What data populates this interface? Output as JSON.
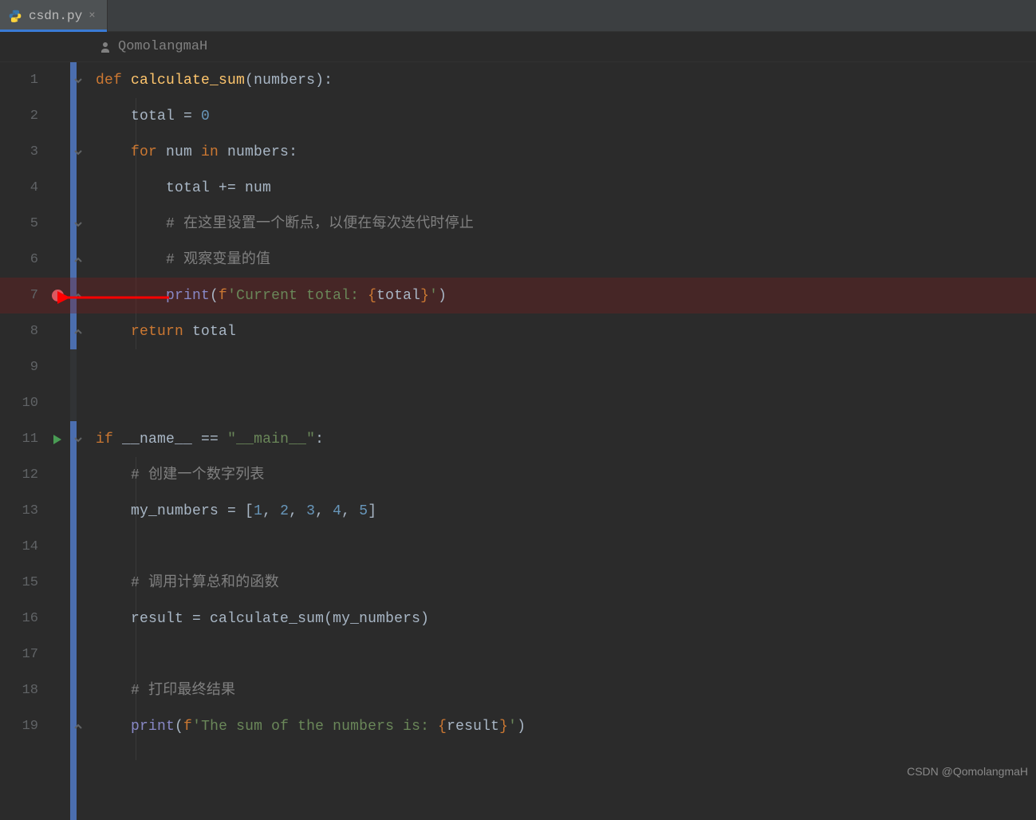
{
  "tab": {
    "filename": "csdn.py",
    "close_glyph": "×"
  },
  "author": {
    "name": "QomolangmaH"
  },
  "breakpoint_line": 7,
  "run_gutter_line": 11,
  "watermark": "CSDN @QomolangmaH",
  "code_lines": [
    {
      "n": 1,
      "fold": "down",
      "tokens": [
        [
          "kw",
          "def "
        ],
        [
          "fn",
          "calculate_sum"
        ],
        [
          "punct",
          "("
        ],
        [
          "var",
          "numbers"
        ],
        [
          "punct",
          ")"
        ],
        [
          "punct",
          ":"
        ]
      ]
    },
    {
      "n": 2,
      "fold": "",
      "tokens": [
        [
          "var",
          "    total "
        ],
        [
          "op",
          "= "
        ],
        [
          "num",
          "0"
        ]
      ]
    },
    {
      "n": 3,
      "fold": "down",
      "tokens": [
        [
          "kw",
          "    for "
        ],
        [
          "var",
          "num "
        ],
        [
          "kw",
          "in "
        ],
        [
          "var",
          "numbers"
        ],
        [
          "punct",
          ":"
        ]
      ]
    },
    {
      "n": 4,
      "fold": "",
      "tokens": [
        [
          "var",
          "        total "
        ],
        [
          "op",
          "+= "
        ],
        [
          "var",
          "num"
        ]
      ]
    },
    {
      "n": 5,
      "fold": "down",
      "tokens": [
        [
          "var",
          "        "
        ],
        [
          "cmt",
          "# 在这里设置一个断点，以便在每次迭代时停止"
        ]
      ]
    },
    {
      "n": 6,
      "fold": "up",
      "tokens": [
        [
          "var",
          "        "
        ],
        [
          "cmt",
          "# 观察变量的值"
        ]
      ]
    },
    {
      "n": 7,
      "fold": "up",
      "tokens": [
        [
          "var",
          "        "
        ],
        [
          "builtin",
          "print"
        ],
        [
          "punct",
          "("
        ],
        [
          "kw",
          "f"
        ],
        [
          "str",
          "'Current total: "
        ],
        [
          "brace",
          "{"
        ],
        [
          "var",
          "total"
        ],
        [
          "brace",
          "}"
        ],
        [
          "str",
          "'"
        ],
        [
          "punct",
          ")"
        ]
      ]
    },
    {
      "n": 8,
      "fold": "up",
      "tokens": [
        [
          "kw",
          "    return "
        ],
        [
          "var",
          "total"
        ]
      ]
    },
    {
      "n": 9,
      "fold": "",
      "tokens": []
    },
    {
      "n": 10,
      "fold": "",
      "tokens": []
    },
    {
      "n": 11,
      "fold": "down",
      "tokens": [
        [
          "kw",
          "if "
        ],
        [
          "var",
          "__name__ "
        ],
        [
          "op",
          "== "
        ],
        [
          "str",
          "\"__main__\""
        ],
        [
          "punct",
          ":"
        ]
      ]
    },
    {
      "n": 12,
      "fold": "",
      "tokens": [
        [
          "var",
          "    "
        ],
        [
          "cmt",
          "# 创建一个数字列表"
        ]
      ]
    },
    {
      "n": 13,
      "fold": "",
      "tokens": [
        [
          "var",
          "    my_numbers "
        ],
        [
          "op",
          "= "
        ],
        [
          "punct",
          "["
        ],
        [
          "num",
          "1"
        ],
        [
          "op",
          ", "
        ],
        [
          "num",
          "2"
        ],
        [
          "op",
          ", "
        ],
        [
          "num",
          "3"
        ],
        [
          "op",
          ", "
        ],
        [
          "num",
          "4"
        ],
        [
          "op",
          ", "
        ],
        [
          "num",
          "5"
        ],
        [
          "punct",
          "]"
        ]
      ]
    },
    {
      "n": 14,
      "fold": "",
      "tokens": []
    },
    {
      "n": 15,
      "fold": "",
      "tokens": [
        [
          "var",
          "    "
        ],
        [
          "cmt",
          "# 调用计算总和的函数"
        ]
      ]
    },
    {
      "n": 16,
      "fold": "",
      "tokens": [
        [
          "var",
          "    result "
        ],
        [
          "op",
          "= "
        ],
        [
          "var",
          "calculate_sum"
        ],
        [
          "punct",
          "("
        ],
        [
          "var",
          "my_numbers"
        ],
        [
          "punct",
          ")"
        ]
      ]
    },
    {
      "n": 17,
      "fold": "",
      "tokens": []
    },
    {
      "n": 18,
      "fold": "",
      "tokens": [
        [
          "var",
          "    "
        ],
        [
          "cmt",
          "# 打印最终结果"
        ]
      ]
    },
    {
      "n": 19,
      "fold": "up",
      "tokens": [
        [
          "var",
          "    "
        ],
        [
          "builtin",
          "print"
        ],
        [
          "punct",
          "("
        ],
        [
          "kw",
          "f"
        ],
        [
          "str",
          "'The sum of the numbers is: "
        ],
        [
          "brace",
          "{"
        ],
        [
          "var",
          "result"
        ],
        [
          "brace",
          "}"
        ],
        [
          "str",
          "'"
        ],
        [
          "punct",
          ")"
        ]
      ]
    }
  ]
}
